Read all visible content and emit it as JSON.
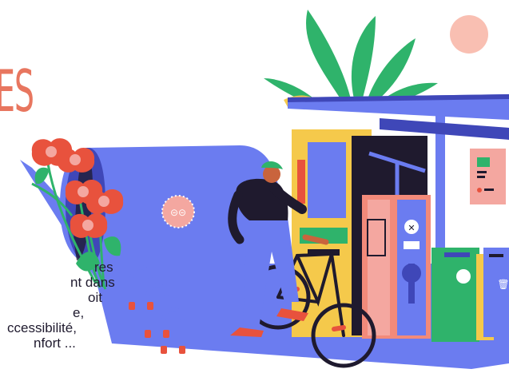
{
  "heading": "ES",
  "paragraph_fragments": [
    "res",
    "nt dans",
    "oit",
    "e,",
    "ccessibilité,",
    "nfort ..."
  ],
  "illustration": {
    "subject": "cyclist wheeling a bicycle toward a covered bike service station",
    "elements": [
      "bike-tunnel shelter",
      "bike racks",
      "tulip flowers",
      "plant leaves",
      "sun",
      "ticket machine",
      "repair pole",
      "trash bins"
    ]
  },
  "colors": {
    "heading": "#e8765f",
    "blue": "#6b7cf0",
    "dark_blue": "#3f47b8",
    "green": "#2fb36b",
    "yellow": "#f5c94b",
    "red": "#e8523d",
    "pink": "#f4a7a0",
    "salmon": "#f28a7a",
    "navy": "#1f1a2e"
  }
}
